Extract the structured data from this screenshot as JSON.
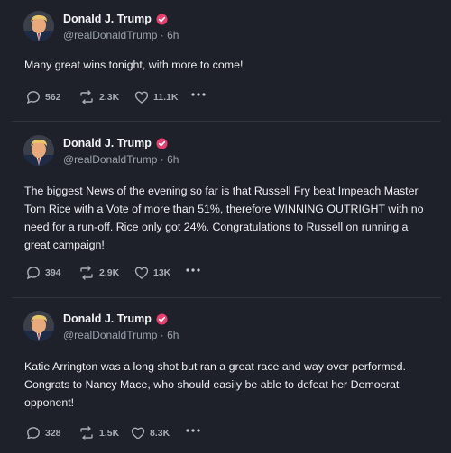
{
  "posts": [
    {
      "author": "Donald J. Trump",
      "handle": "@realDonaldTrump · 6h",
      "text": "Many great wins tonight, with more to come!",
      "replies": "562",
      "retruths": "2.3K",
      "likes": "11.1K"
    },
    {
      "author": "Donald J. Trump",
      "handle": "@realDonaldTrump · 6h",
      "text": "The biggest News of the evening so far is that Russell Fry beat Impeach Master Tom Rice with a Vote of more than 51%, therefore WINNING OUTRIGHT with no need for a run-off. Rice only got 24%. Congratulations to Russell on running a great campaign!",
      "replies": "394",
      "retruths": "2.9K",
      "likes": "13K"
    },
    {
      "author": "Donald J. Trump",
      "handle": "@realDonaldTrump · 6h",
      "text": "Katie Arrington was a long shot but ran a great race and way over performed. Congrats to Nancy Mace, who should easily be able to defeat her Democrat opponent!",
      "replies": "328",
      "retruths": "1.5K",
      "likes": "8.3K"
    }
  ],
  "colors": {
    "background": "#1e2129",
    "verified_badge": "#e83f6f",
    "divider": "#2f3440"
  },
  "icons": {
    "reply": "speech-bubble-icon",
    "retruth": "repost-arrows-icon",
    "like": "heart-icon",
    "more": "ellipsis-icon",
    "verified": "verified-badge-icon"
  }
}
